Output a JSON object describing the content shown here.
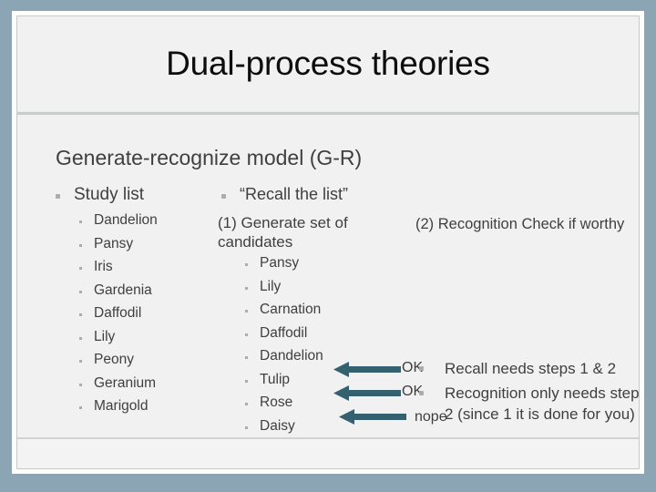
{
  "slide": {
    "title": "Dual-process theories",
    "subtitle": "Generate-recognize model (G-R)",
    "accent_color": "#35606f",
    "background_color": "#8ba5b5",
    "surface_color": "#f1f1f1",
    "text_color": "#3f3f3f"
  },
  "study_column": {
    "heading": "Study list",
    "items": [
      "Dandelion",
      "Pansy",
      "Iris",
      "Gardenia",
      "Daffodil",
      "Lily",
      "Peony",
      "Geranium",
      "Marigold"
    ]
  },
  "recall_column": {
    "heading": "“Recall the list”",
    "step_label": "(1) Generate set of candidates",
    "items": [
      "Pansy",
      "Lily",
      "Carnation",
      "Daffodil",
      "Dandelion",
      "Tulip",
      "Rose",
      "Daisy"
    ]
  },
  "recognition_column": {
    "step_label": "(2) Recognition Check if worthy",
    "verdicts": [
      "OK",
      "OK",
      "nope"
    ],
    "arrows": [
      {
        "name": "arrow-pansy",
        "direction": "left"
      },
      {
        "name": "arrow-lily",
        "direction": "left"
      },
      {
        "name": "arrow-carnation",
        "direction": "left"
      }
    ]
  },
  "conclusions": {
    "items": [
      "Recall needs steps 1 & 2",
      "Recognition only needs step 2 (since 1 it is done for you)"
    ]
  }
}
